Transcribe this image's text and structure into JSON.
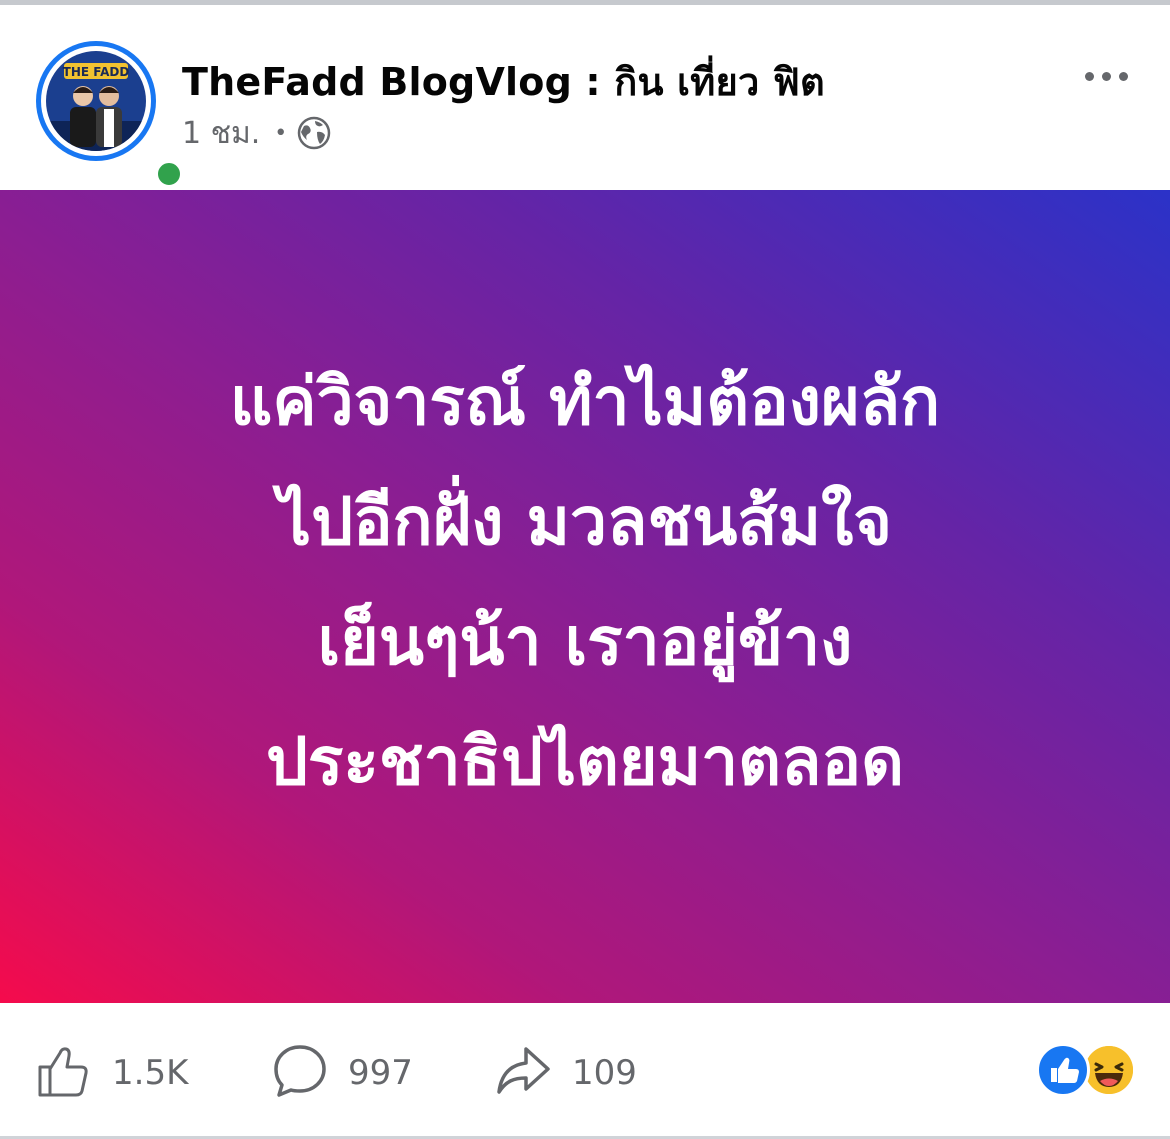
{
  "post": {
    "page_name": "TheFadd BlogVlog : กิน เที่ยว ฟิต",
    "timestamp": "1 ชม.",
    "separator": "•",
    "privacy_icon": "globe-icon",
    "avatar_logo_text": "THE FADD",
    "background_colors": [
      "#2b32c8",
      "#8b1e92",
      "#f50b4c"
    ],
    "text_lines": [
      "แค่วิจารณ์ ทำไมต้องผลัก",
      "ไปอีกฝั่ง มวลชนส้มใจ",
      "เย็นๆน้า เราอยู่ข้าง",
      "ประชาธิปไตยมาตลอด"
    ]
  },
  "actions": {
    "like_count": "1.5K",
    "comment_count": "997",
    "share_count": "109"
  },
  "reactions": [
    "like-reaction-icon",
    "haha-reaction-icon"
  ],
  "colors": {
    "accent": "#1877f2",
    "online": "#31a24c",
    "text_secondary": "#65676b"
  }
}
